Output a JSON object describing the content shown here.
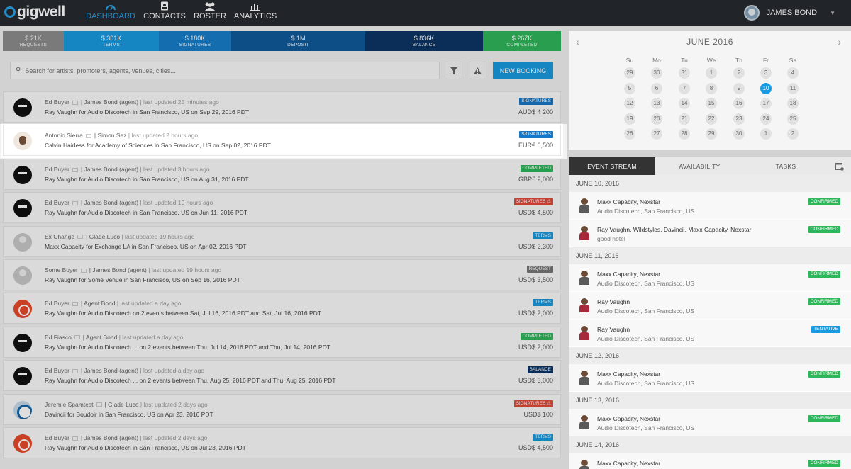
{
  "app": {
    "logo": "gigwell",
    "user_name": "JAMES BOND"
  },
  "nav": [
    {
      "label": "DASHBOARD",
      "icon": "dashboard-icon",
      "active": true
    },
    {
      "label": "CONTACTS",
      "icon": "contacts-icon"
    },
    {
      "label": "ROSTER",
      "icon": "roster-icon"
    },
    {
      "label": "ANALYTICS",
      "icon": "analytics-icon"
    }
  ],
  "stats": [
    {
      "value": "$ 21K",
      "label": "REQUESTS",
      "color": "#8d8d8d"
    },
    {
      "value": "$ 301K",
      "label": "TERMS",
      "color": "#1a9ae0"
    },
    {
      "value": "$ 180K",
      "label": "SIGNATURES",
      "color": "#167ec8"
    },
    {
      "value": "$ 1M",
      "label": "DEPOSIT",
      "color": "#0f5a9c"
    },
    {
      "value": "$ 836K",
      "label": "BALANCE",
      "color": "#0c3566"
    },
    {
      "value": "$ 267K",
      "label": "COMPLETED",
      "color": "#2eb65a"
    }
  ],
  "search": {
    "placeholder": "Search for artists, promoters, agents, venues, cities..."
  },
  "toolbar": {
    "new_booking": "NEW BOOKING"
  },
  "bookings": [
    {
      "avatar": "ninja",
      "line1_a": "Ed Buyer",
      "line1_b": "| James Bond (agent)",
      "line1_c": "| last updated 25 minutes ago",
      "line2": "Ray Vaughn  for  Audio Discotech  in San Francisco, US  on Sep 29, 2016 PDT",
      "badge": "SIGNATURES",
      "badge_color": "#1877c4",
      "amount": "AUD$ 4 200"
    },
    {
      "avatar": "face",
      "line1_a": "Antonio Sierra",
      "line1_b": "| Simon Sez",
      "line1_c": "| last updated 2 hours ago",
      "line2": "Calvin Hairless  for  Academy of Sciences  in San Francisco, US  on Sep 02, 2016 PDT",
      "badge": "SIGNATURES",
      "badge_color": "#1877c4",
      "amount": "EUR€ 6,500"
    },
    {
      "avatar": "ninja",
      "line1_a": "Ed Buyer",
      "line1_b": "| James Bond (agent)",
      "line1_c": "| last updated 3 hours ago",
      "line2": "Ray Vaughn  for  Audio Discotech  in San Francisco, US  on Aug 31, 2016 PDT",
      "badge": "COMPLETED",
      "badge_color": "#2eb65a",
      "amount": "GBP£ 2,000"
    },
    {
      "avatar": "ninja",
      "line1_a": "Ed Buyer",
      "line1_b": "| James Bond (agent)",
      "line1_c": "| last updated 19 hours ago",
      "line2": "Ray Vaughn  for  Audio Discotech  in San Francisco, US  on Jun 11, 2016 PDT",
      "badge": "SIGNATURES ⚠",
      "badge_color": "#e04a3a",
      "amount": "USD$ 4,500"
    },
    {
      "avatar": "gray",
      "line1_a": "Ex Change",
      "line1_b": "| Glade Luco",
      "line1_c": "| last updated 19 hours ago",
      "line2": "Maxx Capacity  for  Exchange LA  in San Francisco, US  on Apr 02, 2016 PDT",
      "badge": "TERMS",
      "badge_color": "#1a9ae0",
      "amount": "USD$ 2,300"
    },
    {
      "avatar": "gray",
      "line1_a": "Some Buyer",
      "line1_b": "| James Bond (agent)",
      "line1_c": "| last updated 19 hours ago",
      "line2": "Ray Vaughn  for  Some Venue  in San Francisco, US  on Sep 16, 2016 PDT",
      "badge": "REQUEST",
      "badge_color": "#777777",
      "amount": "USD$ 3,500"
    },
    {
      "avatar": "red",
      "line1_a": "Ed Buyer",
      "line1_b": "| Agent Bond",
      "line1_c": "| last updated a day ago",
      "line2": "Ray Vaughn  for  Audio Discotech  on 2 events between Sat, Jul 16, 2016 PDT and Sat, Jul 16, 2016 PDT",
      "badge": "TERMS",
      "badge_color": "#1a9ae0",
      "amount": "USD$ 2,000"
    },
    {
      "avatar": "ninja",
      "line1_a": "Ed Fiasco",
      "line1_b": "| Agent Bond",
      "line1_c": "| last updated a day ago",
      "line2": "Ray Vaughn  for  Audio Discotech ...  on 2 events between Thu, Jul 14, 2016 PDT and Thu, Jul 14, 2016 PDT",
      "badge": "COMPLETED",
      "badge_color": "#2eb65a",
      "amount": "USD$ 2,000"
    },
    {
      "avatar": "ninja",
      "line1_a": "Ed Buyer",
      "line1_b": "| James Bond (agent)",
      "line1_c": "| last updated a day ago",
      "line2": "Ray Vaughn  for  Audio Discotech ...  on 2 events between Thu, Aug 25, 2016 PDT and Thu, Aug 25, 2016 PDT",
      "badge": "BALANCE",
      "badge_color": "#0c3566",
      "amount": "USD$ 3,000"
    },
    {
      "avatar": "blue",
      "line1_a": "Jeremie Spamtest",
      "line1_b": "| Glade Luco",
      "line1_c": "| last updated 2 days ago",
      "line2": "Davincii  for  Boudoir  in San Francisco, US  on Apr 23, 2016 PDT",
      "badge": "SIGNATURES ⚠",
      "badge_color": "#e04a3a",
      "amount": "USD$ 100"
    },
    {
      "avatar": "red",
      "line1_a": "Ed Buyer",
      "line1_b": "| James Bond (agent)",
      "line1_c": "| last updated 2 days ago",
      "line2": "Ray Vaughn  for  Audio Discotech  in San Francisco, US  on Jul 23, 2016 PDT",
      "badge": "TERMS",
      "badge_color": "#1a9ae0",
      "amount": "USD$ 4,500"
    }
  ],
  "calendar": {
    "title": "JUNE 2016",
    "dow": [
      "Su",
      "Mo",
      "Tu",
      "We",
      "Th",
      "Fr",
      "Sa"
    ],
    "weeks": [
      [
        "29",
        "30",
        "31",
        "1",
        "2",
        "3",
        "4"
      ],
      [
        "5",
        "6",
        "7",
        "8",
        "9",
        "10",
        "11"
      ],
      [
        "12",
        "13",
        "14",
        "15",
        "16",
        "17",
        "18"
      ],
      [
        "19",
        "20",
        "21",
        "22",
        "23",
        "24",
        "25"
      ],
      [
        "26",
        "27",
        "28",
        "29",
        "30",
        "1",
        "2"
      ]
    ],
    "selected": "10"
  },
  "stream_tabs": [
    {
      "label": "EVENT STREAM",
      "active": true
    },
    {
      "label": "AVAILABILITY"
    },
    {
      "label": "TASKS"
    }
  ],
  "stream": [
    {
      "type": "date",
      "label": "JUNE 10, 2016"
    },
    {
      "type": "item",
      "name": "Maxx Capacity, Nexstar",
      "sub": "Audio Discotech, San Francisco, US",
      "badge": "CONFIRMED",
      "badge_color": "#2eb65a",
      "avatar": "gray"
    },
    {
      "type": "item",
      "name": "Ray Vaughn, Wildstyles, Davincii, Maxx Capacity, Nexstar",
      "sub": "good hotel",
      "badge": "CONFIRMED",
      "badge_color": "#2eb65a",
      "avatar": "red"
    },
    {
      "type": "date",
      "label": "JUNE 11, 2016"
    },
    {
      "type": "item",
      "name": "Maxx Capacity, Nexstar",
      "sub": "Audio Discotech, San Francisco, US",
      "badge": "CONFIRMED",
      "badge_color": "#2eb65a",
      "avatar": "gray"
    },
    {
      "type": "item",
      "name": "Ray Vaughn",
      "sub": "Audio Discotech, San Francisco, US",
      "badge": "CONFIRMED",
      "badge_color": "#2eb65a",
      "avatar": "red"
    },
    {
      "type": "item",
      "name": "Ray Vaughn",
      "sub": "Audio Discotech, San Francisco, US",
      "badge": "TENTATIVE",
      "badge_color": "#1a9ae0",
      "avatar": "red"
    },
    {
      "type": "date",
      "label": "JUNE 12, 2016"
    },
    {
      "type": "item",
      "name": "Maxx Capacity, Nexstar",
      "sub": "Audio Discotech, San Francisco, US",
      "badge": "CONFIRMED",
      "badge_color": "#2eb65a",
      "avatar": "gray"
    },
    {
      "type": "date",
      "label": "JUNE 13, 2016"
    },
    {
      "type": "item",
      "name": "Maxx Capacity, Nexstar",
      "sub": "Audio Discotech, San Francisco, US",
      "badge": "CONFIRMED",
      "badge_color": "#2eb65a",
      "avatar": "gray"
    },
    {
      "type": "date",
      "label": "JUNE 14, 2016"
    },
    {
      "type": "item",
      "name": "Maxx Capacity, Nexstar",
      "sub": "",
      "badge": "CONFIRMED",
      "badge_color": "#2eb65a",
      "avatar": "gray"
    }
  ]
}
